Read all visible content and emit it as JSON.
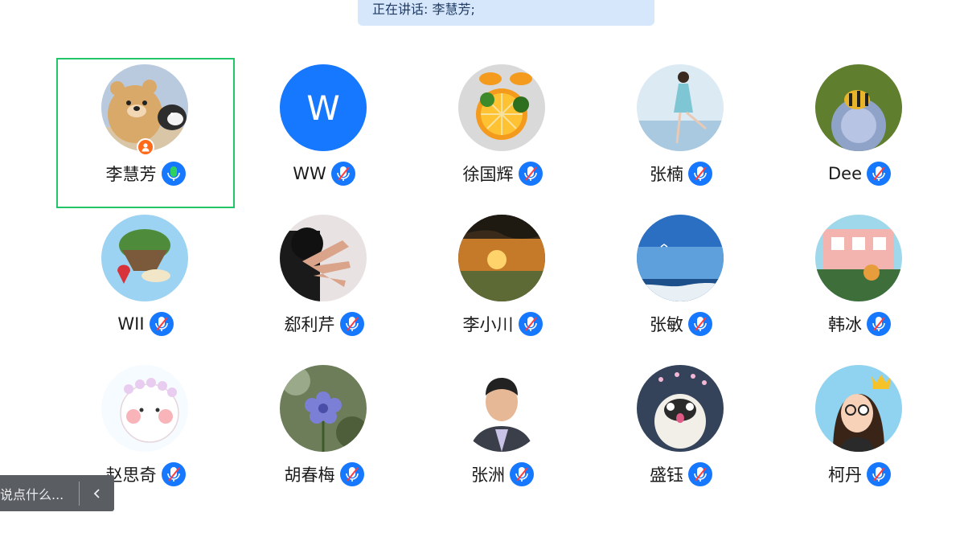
{
  "banner": {
    "speaking_text": "正在讲话: 李慧芳;"
  },
  "participants": [
    {
      "name": "李慧芳",
      "avatar": "bear-cartoon-avatar",
      "mic": "active",
      "host": true
    },
    {
      "name": "WW",
      "avatar": "letter-avatar",
      "letter": "W",
      "mic": "muted"
    },
    {
      "name": "徐国辉",
      "avatar": "orange-fruit-avatar",
      "mic": "muted"
    },
    {
      "name": "张楠",
      "avatar": "girl-water-avatar",
      "mic": "muted"
    },
    {
      "name": "Dee",
      "avatar": "bee-flower-avatar",
      "mic": "muted"
    },
    {
      "name": "WII",
      "avatar": "floating-island-avatar",
      "mic": "muted"
    },
    {
      "name": "郄利芹",
      "avatar": "hand-photo-avatar",
      "mic": "muted"
    },
    {
      "name": "李小川",
      "avatar": "sunset-avatar",
      "mic": "muted"
    },
    {
      "name": "张敏",
      "avatar": "sea-sky-avatar",
      "mic": "muted"
    },
    {
      "name": "韩冰",
      "avatar": "cafe-illustration-avatar",
      "mic": "muted"
    },
    {
      "name": "赵思奇",
      "avatar": "cute-cartoon-avatar",
      "mic": "muted"
    },
    {
      "name": "胡春梅",
      "avatar": "blue-flower-avatar",
      "mic": "muted"
    },
    {
      "name": "张洲",
      "avatar": "man-portrait-avatar",
      "mic": "muted"
    },
    {
      "name": "盛钰",
      "avatar": "pug-avatar",
      "mic": "muted"
    },
    {
      "name": "柯丹",
      "avatar": "crown-girl-avatar",
      "mic": "muted"
    }
  ],
  "chat": {
    "placeholder": "说点什么...",
    "toggle_icon": "chevron-left-icon"
  },
  "colors": {
    "accent": "#1677ff",
    "active_border": "#22c56a",
    "mic_active": "#2fd15e",
    "host_badge": "#ff6a1a",
    "banner_bg": "#d6e6fb"
  }
}
